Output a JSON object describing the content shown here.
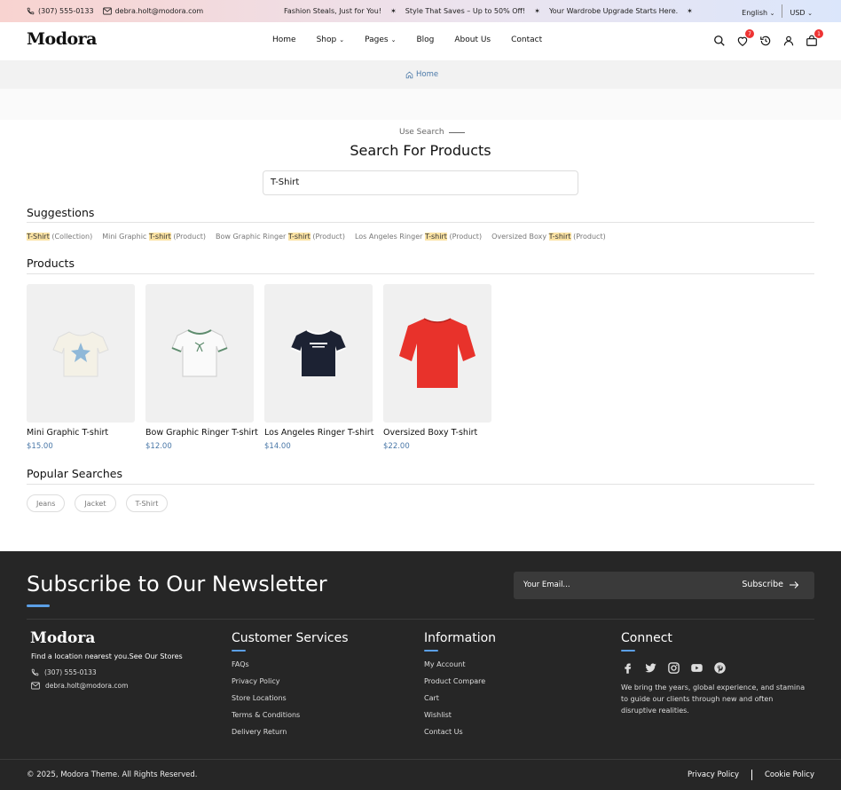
{
  "topbar": {
    "phone": "(307) 555-0133",
    "email": "debra.holt@modora.com",
    "promos": [
      "Fashion Steals, Just for You!",
      "Style That Saves – Up to 50% Off!",
      "Your Wardrobe Upgrade Starts Here."
    ],
    "language": "English",
    "currency": "USD"
  },
  "header": {
    "logo": "Modora",
    "nav": [
      {
        "label": "Home",
        "dropdown": false
      },
      {
        "label": "Shop",
        "dropdown": true
      },
      {
        "label": "Pages",
        "dropdown": true
      },
      {
        "label": "Blog",
        "dropdown": false
      },
      {
        "label": "About Us",
        "dropdown": false
      },
      {
        "label": "Contact",
        "dropdown": false
      }
    ],
    "wishlist_count": "7",
    "cart_count": "1"
  },
  "breadcrumb": {
    "home": "Home"
  },
  "search": {
    "eyebrow": "Use Search",
    "title": "Search For Products",
    "query": "T-Shirt"
  },
  "suggestions": {
    "title": "Suggestions",
    "items": [
      {
        "pre": "",
        "hl": "T-Shirt",
        "post": " (Collection)"
      },
      {
        "pre": "Mini Graphic ",
        "hl": "T-shirt",
        "post": " (Product)"
      },
      {
        "pre": "Bow Graphic Ringer ",
        "hl": "T-shirt",
        "post": " (Product)"
      },
      {
        "pre": "Los Angeles Ringer ",
        "hl": "T-shirt",
        "post": " (Product)"
      },
      {
        "pre": "Oversized Boxy ",
        "hl": "T-shirt",
        "post": " (Product)"
      }
    ]
  },
  "products": {
    "title": "Products",
    "items": [
      {
        "name": "Mini Graphic T-shirt",
        "price": "$15.00",
        "color": "#f4f1e6",
        "graphic": "#8fb8d8"
      },
      {
        "name": "Bow Graphic Ringer T-shirt",
        "price": "$12.00",
        "color": "#fafafa",
        "graphic": "#5e8c6e"
      },
      {
        "name": "Los Angeles Ringer T-shirt",
        "price": "$14.00",
        "color": "#1c2233",
        "graphic": "#ffffff"
      },
      {
        "name": "Oversized Boxy T-shirt",
        "price": "$22.00",
        "color": "#e8322b",
        "graphic": "#e8322b"
      }
    ]
  },
  "popular": {
    "title": "Popular Searches",
    "chips": [
      "Jeans",
      "Jacket",
      "T-Shirt"
    ]
  },
  "footer": {
    "newsletter_title": "Subscribe to Our Newsletter",
    "email_placeholder": "Your Email...",
    "subscribe_label": "Subscribe",
    "logo": "Modora",
    "find_text": "Find a location nearest you.See Our Stores",
    "phone": "(307) 555-0133",
    "email": "debra.holt@modora.com",
    "customer_services": {
      "title": "Customer Services",
      "links": [
        "FAQs",
        "Privacy Policy",
        "Store Locations",
        "Terms & Conditions",
        "Delivery Return"
      ]
    },
    "information": {
      "title": "Information",
      "links": [
        "My Account",
        "Product Compare",
        "Cart",
        "Wishlist",
        "Contact Us"
      ]
    },
    "connect": {
      "title": "Connect",
      "socials": [
        "facebook-icon",
        "twitter-icon",
        "instagram-icon",
        "youtube-icon",
        "pinterest-icon"
      ],
      "text": "We bring the years, global experience, and stamina to guide our clients through new and often disruptive realities."
    },
    "copyright": "© 2025, Modora Theme. All Rights Reserved.",
    "privacy": "Privacy Policy",
    "cookie": "Cookie Policy"
  }
}
